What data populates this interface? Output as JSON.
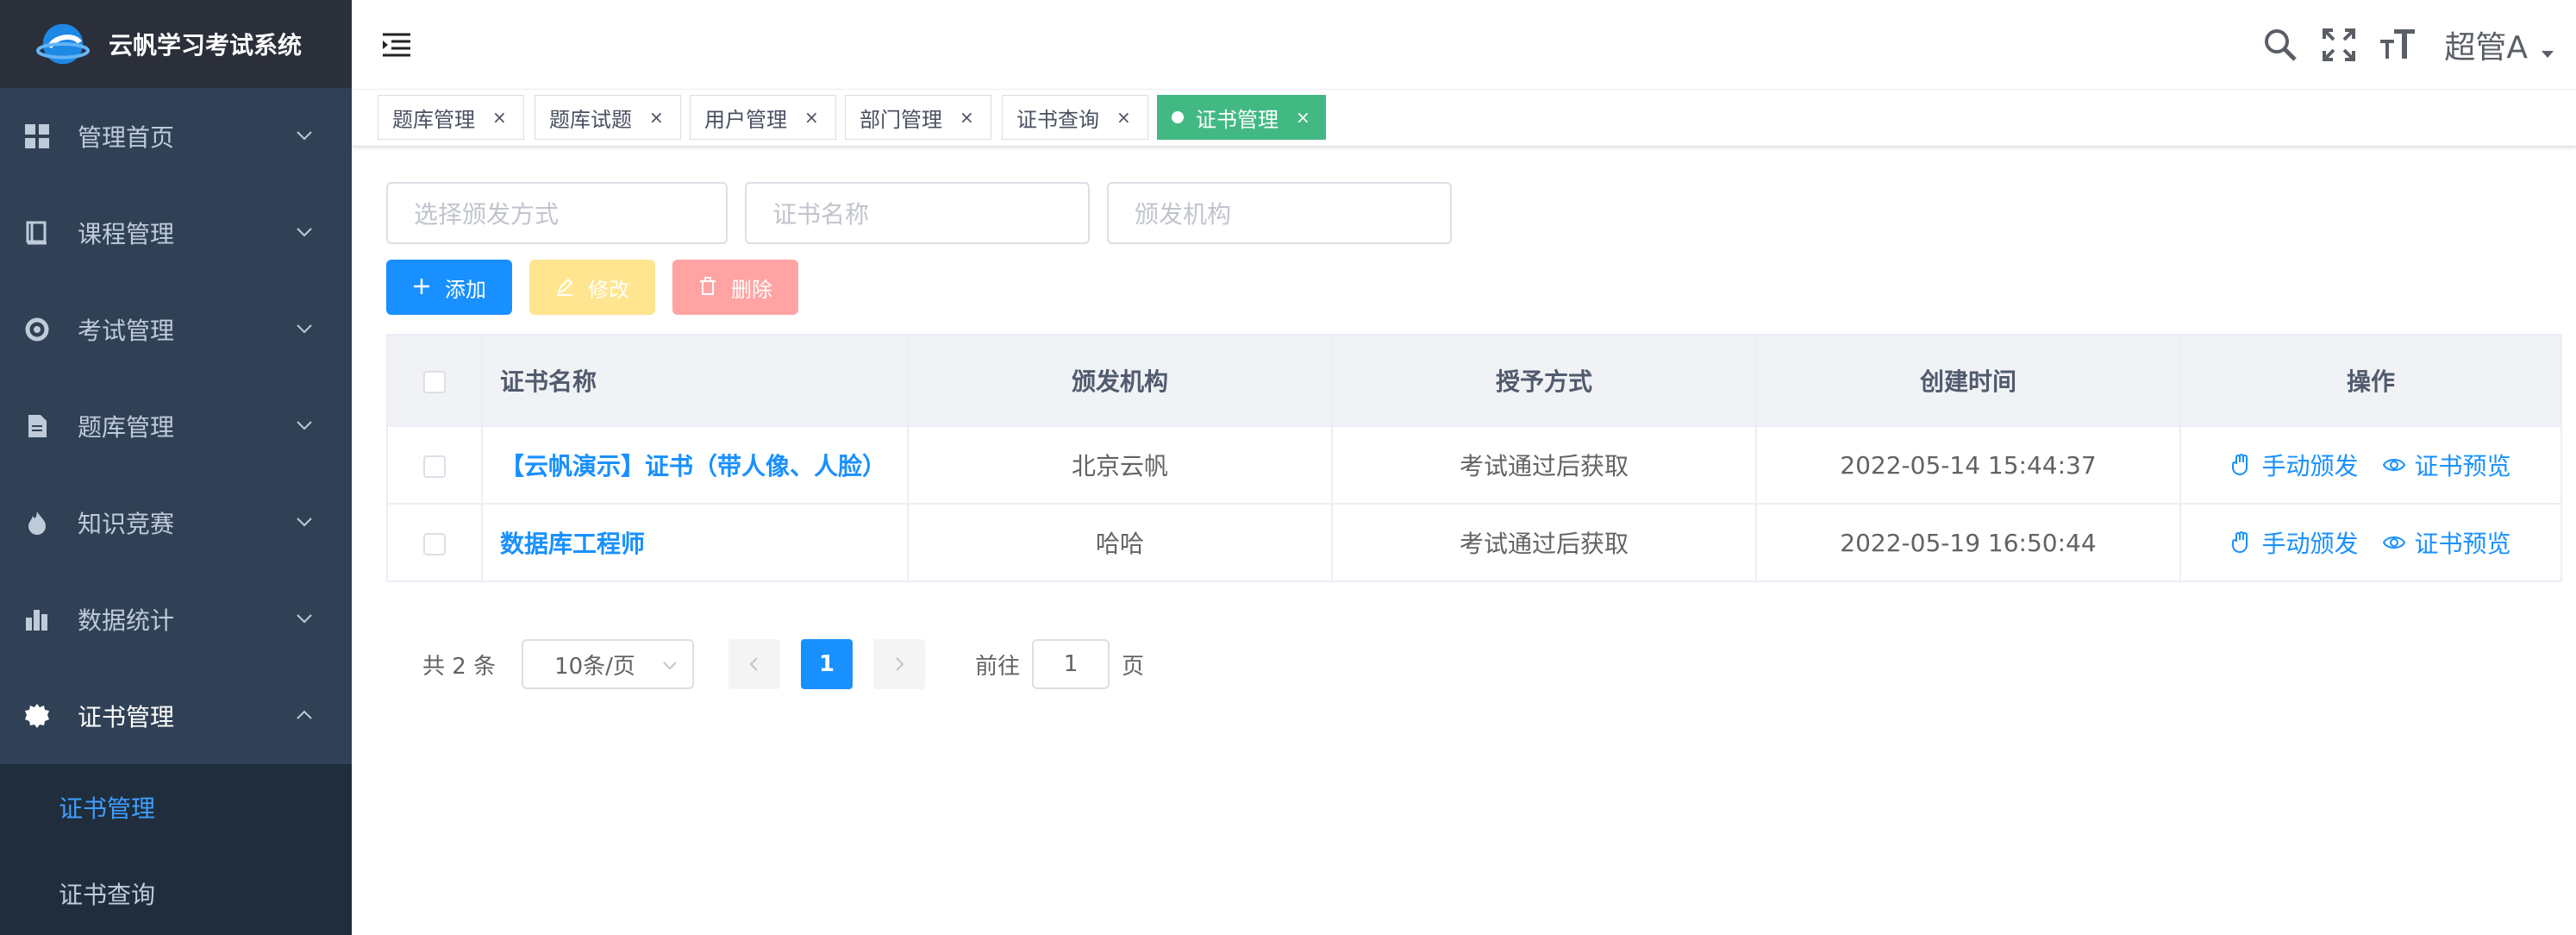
{
  "app": {
    "title": "云帆学习考试系统"
  },
  "sidebar": {
    "items": [
      {
        "label": "管理首页",
        "icon": "dashboard-icon"
      },
      {
        "label": "课程管理",
        "icon": "book-icon"
      },
      {
        "label": "考试管理",
        "icon": "exam-icon"
      },
      {
        "label": "题库管理",
        "icon": "document-icon"
      },
      {
        "label": "知识竞赛",
        "icon": "fire-icon"
      },
      {
        "label": "数据统计",
        "icon": "bar-chart-icon"
      },
      {
        "label": "证书管理",
        "icon": "gear-icon",
        "expanded": true
      }
    ],
    "submenu": [
      {
        "label": "证书管理",
        "active": true
      },
      {
        "label": "证书查询",
        "active": false
      }
    ]
  },
  "navbar": {
    "user": "超管A"
  },
  "tags": [
    {
      "label": "题库管理"
    },
    {
      "label": "题库试题"
    },
    {
      "label": "用户管理"
    },
    {
      "label": "部门管理"
    },
    {
      "label": "证书查询"
    },
    {
      "label": "证书管理",
      "active": true
    }
  ],
  "filters": {
    "method_placeholder": "选择颁发方式",
    "name_placeholder": "证书名称",
    "org_placeholder": "颁发机构"
  },
  "toolbar": {
    "add_label": "添加",
    "edit_label": "修改",
    "delete_label": "删除"
  },
  "table": {
    "columns": [
      "证书名称",
      "颁发机构",
      "授予方式",
      "创建时间",
      "操作"
    ],
    "rows": [
      {
        "name": "【云帆演示】证书（带人像、人脸）",
        "org": "北京云帆",
        "method": "考试通过后获取",
        "created": "2022-05-14 15:44:37"
      },
      {
        "name": "数据库工程师",
        "org": "哈哈",
        "method": "考试通过后获取",
        "created": "2022-05-19 16:50:44"
      }
    ],
    "actions": {
      "issue": "手动颁发",
      "preview": "证书预览"
    }
  },
  "pagination": {
    "total_text": "共 2 条",
    "page_size": "10条/页",
    "current_page": "1",
    "goto_label": "前往",
    "goto_value": "1",
    "page_suffix": "页"
  },
  "colors": {
    "sidebar": "#304156",
    "primary": "#1890ff",
    "tag_active": "#42b983",
    "active_menu": "#409eff"
  }
}
